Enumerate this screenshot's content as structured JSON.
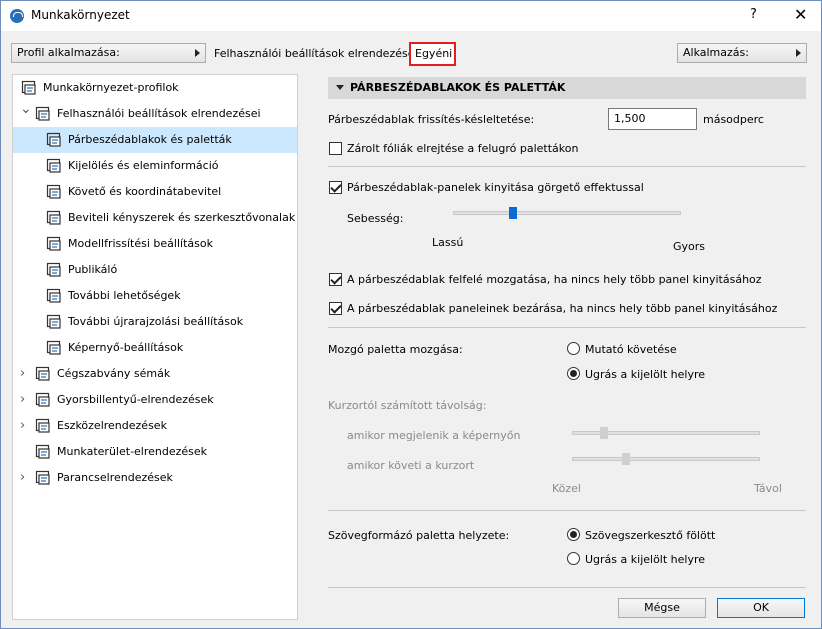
{
  "window": {
    "title": "Munkakörnyezet",
    "help": "?",
    "close": "✕"
  },
  "topbar": {
    "profile_btn": "Profil alkalmazása:",
    "label": "Felhasználói beállítások elrendezései :",
    "current": "Egyéni",
    "apply_btn": "Alkalmazás:"
  },
  "tree": [
    {
      "label": "Munkakörnyezet-profilok",
      "icon": "profiles-icon"
    },
    {
      "label": "Felhasználói beállítások elrendezései",
      "icon": "user-settings-icon",
      "expanded": true
    },
    {
      "label": "Párbeszédablakok és paletták",
      "icon": "dialogs-palettes-icon",
      "selected": true
    },
    {
      "label": "Kijelölés és eleminformáció",
      "icon": "selection-info-icon"
    },
    {
      "label": "Követő és koordinátabevitel",
      "icon": "xyz-icon"
    },
    {
      "label": "Beviteli kényszerek és szerkesztővonalak",
      "icon": "cursor-constraint-icon"
    },
    {
      "label": "Modellfrissítési beállítások",
      "icon": "model-refresh-icon"
    },
    {
      "label": "Publikáló",
      "icon": "publisher-icon"
    },
    {
      "label": "További lehetőségek",
      "icon": "more-options-icon"
    },
    {
      "label": "További újrarajzolási beállítások",
      "icon": "redraw-icon"
    },
    {
      "label": "Képernyő-beállítások",
      "icon": "screen-icon"
    },
    {
      "label": "Cégszabvány sémák",
      "icon": "company-schemes-icon"
    },
    {
      "label": "Gyorsbillentyű-elrendezések",
      "icon": "shortcut-icon"
    },
    {
      "label": "Eszközelrendezések",
      "icon": "tools-icon"
    },
    {
      "label": "Munkaterület-elrendezések",
      "icon": "workspace-icon"
    },
    {
      "label": "Parancselrendezések",
      "icon": "commands-icon"
    }
  ],
  "panel": {
    "section_title": "PÁRBESZÉDABLAKOK ÉS PALETTÁK",
    "refresh_label": "Párbeszédablak frissítés-késleltetése:",
    "refresh_value": "1,500",
    "refresh_unit": "másodperc",
    "hide_locked": {
      "label": "Zárolt fóliák elrejtése a felugró palettákon",
      "checked": false
    },
    "scroll_effect": {
      "label": "Párbeszédablak-panelek kinyitása görgető effektussal",
      "checked": true
    },
    "speed": {
      "label": "Sebesség:",
      "min_label": "Lassú",
      "max_label": "Gyors",
      "value": 0.25
    },
    "move_up": {
      "label": "A párbeszédablak felfelé mozgatása, ha nincs hely több panel kinyitásához",
      "checked": true
    },
    "close_panels": {
      "label": "A párbeszédablak paneleinek bezárása, ha nincs hely több panel kinyitásához",
      "checked": true
    },
    "moving_palette": {
      "label": "Mozgó paletta mozgása:",
      "options": [
        "Mutató követése",
        "Ugrás a kijelölt helyre"
      ],
      "selected": 1
    },
    "cursor_distance": {
      "label": "Kurzortól számított távolság:",
      "appear_label": "amikor megjelenik a képernyőn",
      "appear_value": 0.15,
      "follow_label": "amikor követi a kurzort",
      "follow_value": 0.27,
      "min_label": "Közel",
      "max_label": "Távol"
    },
    "text_palette": {
      "label": "Szövegformázó paletta helyzete:",
      "options": [
        "Szövegszerkesztő fölött",
        "Ugrás a kijelölt helyre"
      ],
      "selected": 0
    }
  },
  "buttons": {
    "cancel": "Mégse",
    "ok": "OK"
  }
}
